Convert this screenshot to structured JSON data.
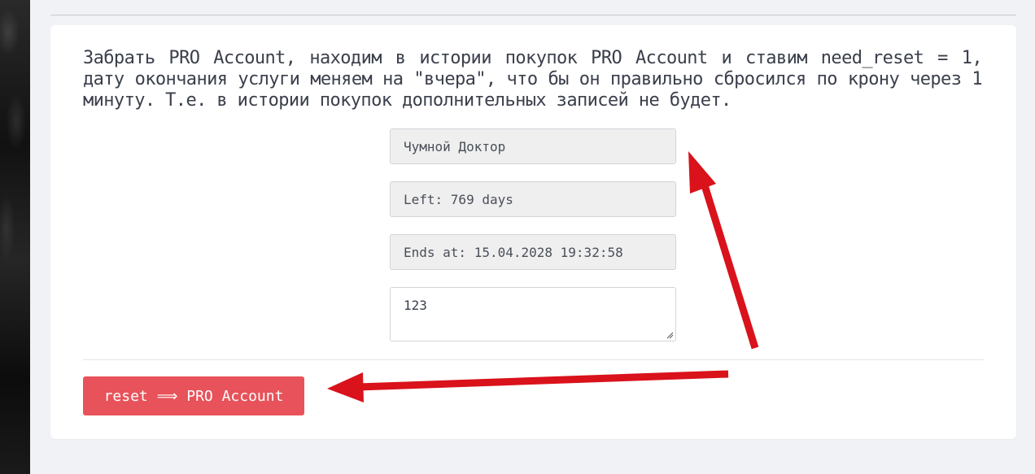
{
  "description": "Забрать PRO Account, находим в истории покупок PRO Account и ставим need_reset = 1, дату окончания услуги меняем на \"вчера\", что бы он правильно сбросился по крону через 1 минуту. Т.е. в истории покупок дополнительных записей не будет.",
  "fields": {
    "name": "Чумной Доктор",
    "left": "Left: 769 days",
    "ends_at": "Ends at: 15.04.2028 19:32:58"
  },
  "comment": {
    "value": "123"
  },
  "actions": {
    "reset_label": "reset ⟹ PRO Account"
  },
  "annotation": {
    "arrow_color": "#d9121b",
    "button_color": "#e8525a"
  }
}
